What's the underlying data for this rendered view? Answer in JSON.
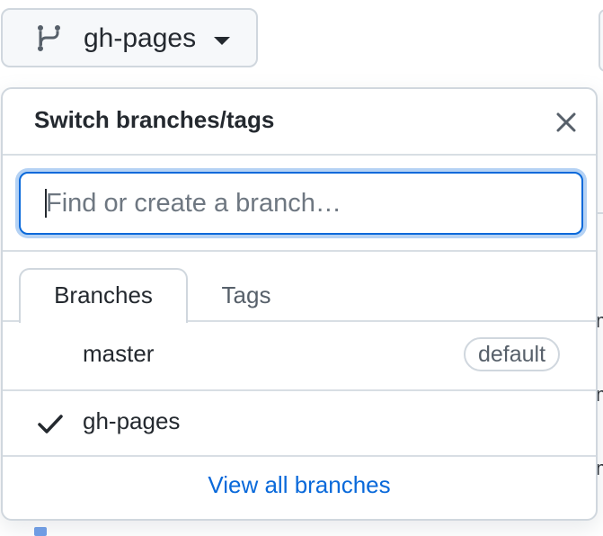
{
  "branch_button": {
    "current_branch": "gh-pages",
    "icon": "git-branch-icon"
  },
  "dropdown": {
    "title": "Switch branches/tags",
    "search": {
      "placeholder": "Find or create a branch…",
      "value": ""
    },
    "tabs": [
      {
        "label": "Branches",
        "selected": true
      },
      {
        "label": "Tags",
        "selected": false
      }
    ],
    "branches": [
      {
        "name": "master",
        "badge": "default",
        "selected": false
      },
      {
        "name": "gh-pages",
        "badge": "",
        "selected": true
      }
    ],
    "view_all_label": "View all branches"
  },
  "colors": {
    "accent": "#0969da",
    "border": "#d0d7de",
    "text": "#24292f",
    "muted": "#57606a"
  }
}
